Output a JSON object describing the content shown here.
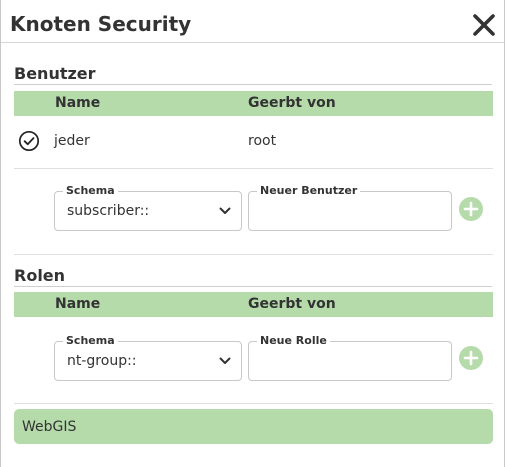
{
  "dialog": {
    "title": "Knoten Security"
  },
  "users_section": {
    "title": "Benutzer",
    "columns": [
      "Name",
      "Geerbt von"
    ],
    "rows": [
      {
        "name": "jeder",
        "inherited_from": "root",
        "icon": "check-circle-icon"
      }
    ],
    "schema_label": "Schema",
    "schema_value": "subscriber::",
    "new_label": "Neuer Benutzer",
    "new_value": ""
  },
  "roles_section": {
    "title": "Rolen",
    "columns": [
      "Name",
      "Geerbt von"
    ],
    "schema_label": "Schema",
    "schema_value": "nt-group::",
    "new_label": "Neue Rolle",
    "new_value": ""
  },
  "group": {
    "label": "WebGIS"
  },
  "colors": {
    "accent": "#b5dbab",
    "text": "#333333",
    "border": "#c8c8c8"
  }
}
